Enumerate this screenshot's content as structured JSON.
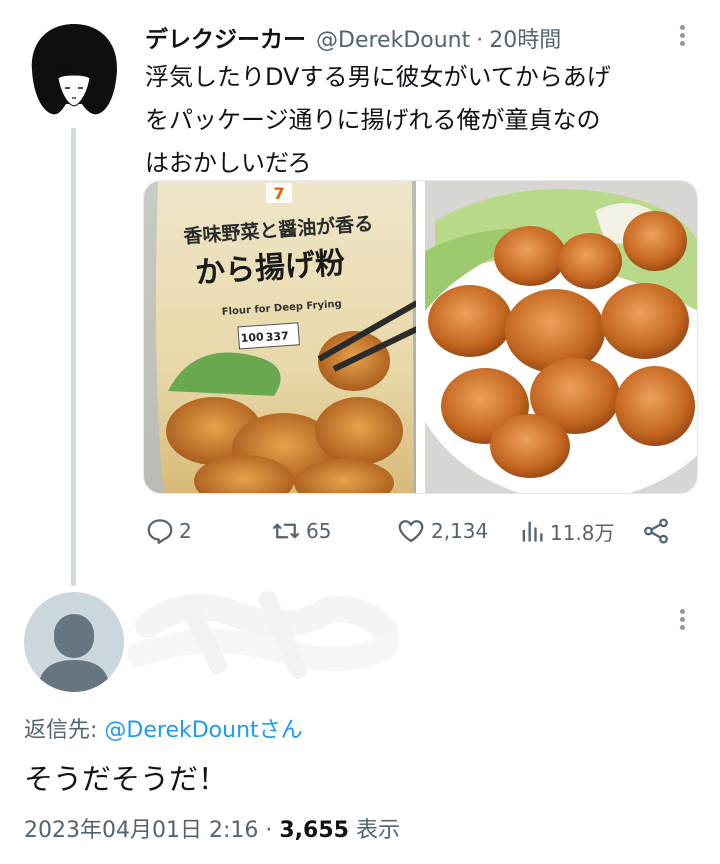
{
  "tweet": {
    "author_name": "デレクジーカー",
    "author_handle": "@DerekDount",
    "separator": "·",
    "time": "20時間",
    "text_lines": [
      "浮気したりDVする男に彼女がいてからあげ",
      "をパッケージ通りに揚げれる俺が童貞なの",
      "はおかしいだろ"
    ],
    "media": {
      "package": {
        "brand_mark": "7",
        "headline": "香味野菜と醤油が香る",
        "title": "から揚げ粉",
        "english": "Flour for Deep Frying",
        "nutrition": [
          "100",
          "337"
        ]
      }
    },
    "actions": {
      "replies": "2",
      "retweets": "65",
      "likes": "2,134",
      "views": "11.8万"
    }
  },
  "reply": {
    "reply_to_prefix": "返信先: ",
    "reply_to_handle": "@DerekDount",
    "reply_to_suffix": "さん",
    "text": "そうだそうだ！",
    "timestamp": "2023年04月01日 2:16",
    "separator": "·",
    "view_count": "3,655",
    "view_label": "表示"
  },
  "colors": {
    "link": "#1d9bf0",
    "secondary_text": "#536471",
    "thread_line": "#cfd9de",
    "default_avatar": "#ccd6dd"
  }
}
